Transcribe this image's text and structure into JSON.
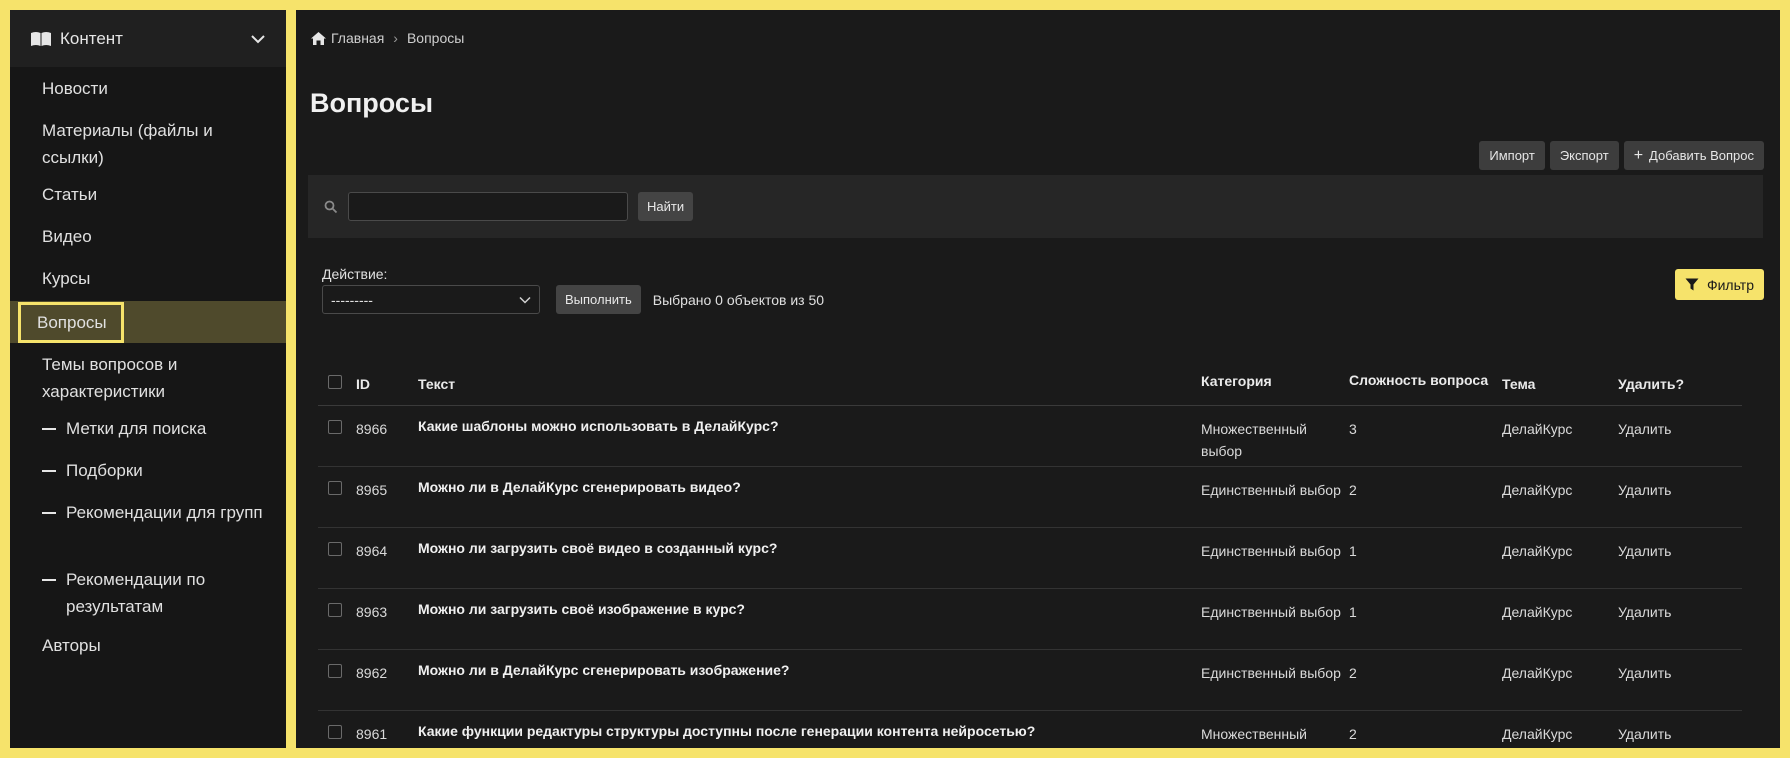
{
  "sidebar": {
    "section_title": "Контент",
    "items": [
      {
        "label": "Новости"
      },
      {
        "label": "Материалы (файлы и ссылки)"
      },
      {
        "label": "Статьи"
      },
      {
        "label": "Видео"
      },
      {
        "label": "Курсы"
      },
      {
        "label": "Вопросы",
        "active": true
      },
      {
        "label": "Темы вопросов и характеристики"
      },
      {
        "label": "Метки для поиска",
        "sub": true
      },
      {
        "label": "Подборки",
        "sub": true
      },
      {
        "label": "Рекомендации для групп",
        "sub": true
      },
      {
        "label": "Рекомендации по результатам",
        "sub": true
      },
      {
        "label": "Авторы"
      }
    ]
  },
  "breadcrumb": {
    "home": "Главная",
    "current": "Вопросы"
  },
  "page_title": "Вопросы",
  "toolbar": {
    "import": "Импорт",
    "export": "Экспорт",
    "add": "Добавить Вопрос"
  },
  "search": {
    "value": "",
    "button": "Найти"
  },
  "actions": {
    "label": "Действие:",
    "selected": "---------",
    "run": "Выполнить",
    "selected_count": "Выбрано 0 объектов из 50"
  },
  "filter": {
    "label": "Фильтр"
  },
  "colors": {
    "accent": "#f6e36b",
    "sidebar_bg": "#161616",
    "main_bg": "#1a1a1a"
  },
  "table": {
    "headers": {
      "id": "ID",
      "text": "Текст",
      "category": "Категория",
      "difficulty": "Сложность вопроса",
      "theme": "Тема",
      "delete": "Удалить?"
    },
    "rows": [
      {
        "id": "8966",
        "text": "Какие шаблоны можно использовать в ДелайКурс?",
        "category": "Множественный выбор",
        "difficulty": "3",
        "theme": "ДелайКурс",
        "delete": "Удалить"
      },
      {
        "id": "8965",
        "text": "Можно ли в ДелайКурс сгенерировать видео?",
        "category": "Единственный выбор",
        "difficulty": "2",
        "theme": "ДелайКурс",
        "delete": "Удалить"
      },
      {
        "id": "8964",
        "text": "Можно ли загрузить своё видео в созданный курс?",
        "category": "Единственный выбор",
        "difficulty": "1",
        "theme": "ДелайКурс",
        "delete": "Удалить"
      },
      {
        "id": "8963",
        "text": "Можно ли загрузить своё изображение в курс?",
        "category": "Единственный выбор",
        "difficulty": "1",
        "theme": "ДелайКурс",
        "delete": "Удалить"
      },
      {
        "id": "8962",
        "text": "Можно ли в ДелайКурс сгенерировать изображение?",
        "category": "Единственный выбор",
        "difficulty": "2",
        "theme": "ДелайКурс",
        "delete": "Удалить"
      },
      {
        "id": "8961",
        "text": "Какие функции редактуры структуры доступны после генерации контента нейросетью?",
        "category": "Множественный выбор",
        "difficulty": "2",
        "theme": "ДелайКурс",
        "delete": "Удалить"
      }
    ]
  }
}
